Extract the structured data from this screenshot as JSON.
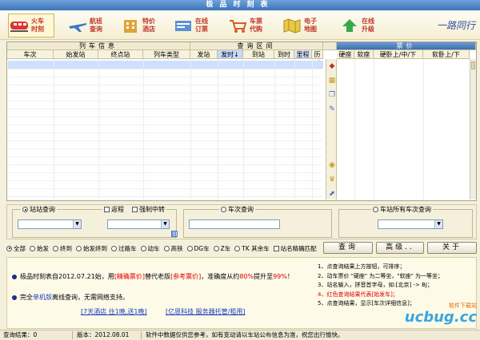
{
  "window": {
    "title": "极品时刻表"
  },
  "toolbar": {
    "buttons": [
      {
        "line1": "火车",
        "line2": "时刻"
      },
      {
        "line1": "航班",
        "line2": "查询"
      },
      {
        "line1": "特价",
        "line2": "酒店"
      },
      {
        "line1": "在线",
        "line2": "订票"
      },
      {
        "line1": "车票",
        "line2": "代购"
      },
      {
        "line1": "电子",
        "line2": "地图"
      },
      {
        "line1": "在线",
        "line2": "升级"
      }
    ],
    "signature": "一路同行"
  },
  "grid": {
    "groups": {
      "train_info": "列车信息",
      "query_segment": "查询区间",
      "fare": "票价"
    },
    "columns": {
      "train_no": "车次",
      "origin": "始发站",
      "terminal": "终点站",
      "train_type": "列车类型",
      "depart_station": "发站",
      "depart_time": "发时↓",
      "arrive_station": "到站",
      "arrive_time": "到时",
      "distance": "里程",
      "duration": "历时",
      "hard_seat": "硬座",
      "soft_seat": "软座",
      "hard_sleeper": "硬卧上/中/下",
      "soft_sleeper": "软卧上/下"
    }
  },
  "search": {
    "station_query": "站站查询",
    "return_trip": "返程",
    "force_transfer": "强制中转",
    "train_query": "车次查询",
    "all_trains_query": "车站所有车次查询"
  },
  "filters": {
    "options": [
      "全部",
      "始发",
      "终到",
      "始发终到",
      "过路车",
      "动车",
      "高铁",
      "DG车",
      "Z车",
      "TK 其余车",
      "站名精确匹配"
    ]
  },
  "buttons": {
    "query": "查询",
    "advanced": "高级..",
    "close": "关于"
  },
  "info": {
    "line1_prefix": "极品时刻表自2012.07.21始，用",
    "line1_link": "[精确票价]",
    "line1_mid": "替代老版",
    "line1_ref": "[参考票价]",
    "line1_mid2": "，准确度从约",
    "line1_pct_old": "80%",
    "line1_mid3": "提升至",
    "line1_pct_new": "99%",
    "line1_end": "！",
    "line2_prefix": "完全",
    "line2_link": "单机版",
    "line2_end": "离线查询，无需网络支持。",
    "link_hotel": "[7天酒店 住1晚,送1晚]",
    "link_software": "[亿恩科技 服务器托管/租用]",
    "tips": [
      "1、点查询结果上方按钮，可排序；",
      "2、动车票价 \"硬座\" 为二等坐，\"软座\" 为一等坐；",
      "3、站名输入，拼音首字母，如:[北京] -> BJ；",
      "4、红色查询结果代表[始发车]；",
      "5、点查询结果，显示[车次详细信息]；"
    ]
  },
  "watermark": {
    "big": "ucbug.cc",
    "small": "软件下载站"
  },
  "status": {
    "result_count": "查询结果：0",
    "version": "版本：2012.08.01",
    "disclaimer": "软件中数据仅供您参考，如有变动请以车站公布信息为准，祝您出行愉快。"
  }
}
